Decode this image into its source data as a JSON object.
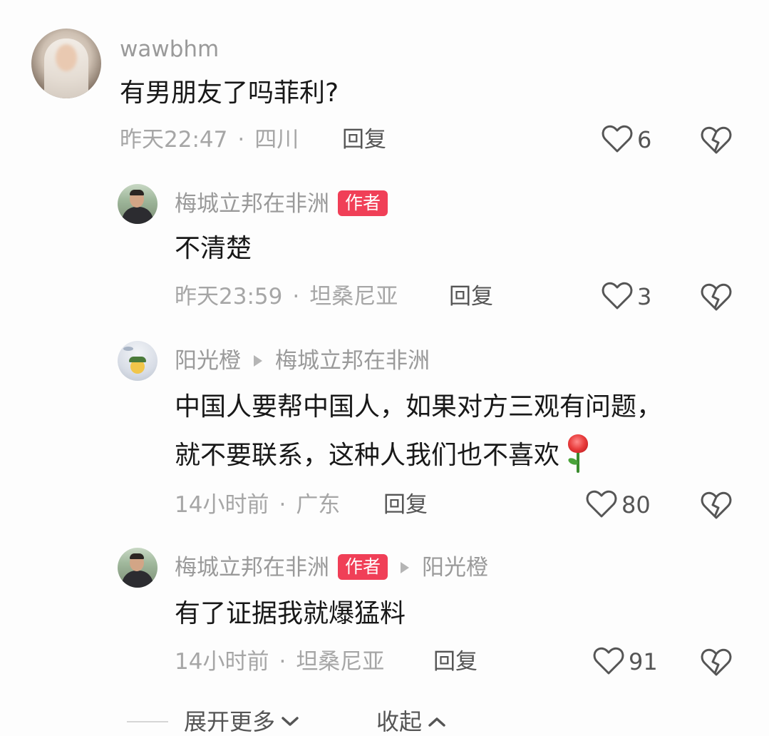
{
  "comments": [
    {
      "username": "wawbhm",
      "text": "有男朋友了吗菲利?",
      "time": "昨天22:47",
      "location": "四川",
      "reply_label": "回复",
      "likes": "6"
    },
    {
      "username": "梅城立邦在非洲",
      "badge": "作者",
      "text": "不清楚",
      "time": "昨天23:59",
      "location": "坦桑尼亚",
      "reply_label": "回复",
      "likes": "3"
    },
    {
      "username": "阳光橙",
      "reply_to": "梅城立邦在非洲",
      "text_line1": "中国人要帮中国人，如果对方三观有问题，",
      "text_line2": "就不要联系，这种人我们也不喜欢",
      "time": "14小时前",
      "location": "广东",
      "reply_label": "回复",
      "likes": "80"
    },
    {
      "username": "梅城立邦在非洲",
      "badge": "作者",
      "reply_to": "阳光橙",
      "text": "有了证据我就爆猛料",
      "time": "14小时前",
      "location": "坦桑尼亚",
      "reply_label": "回复",
      "likes": "91"
    }
  ],
  "dot": "·",
  "footer": {
    "expand_label": "展开更多",
    "collapse_label": "收起"
  },
  "colors": {
    "badge": "#f03f57",
    "meta": "#a6a6a6",
    "username": "#9a9a9a",
    "text": "#181818"
  },
  "icons": [
    "heart-outline-icon",
    "broken-heart-icon",
    "rose-emoji-icon",
    "chevron-down-icon",
    "chevron-up-icon"
  ]
}
